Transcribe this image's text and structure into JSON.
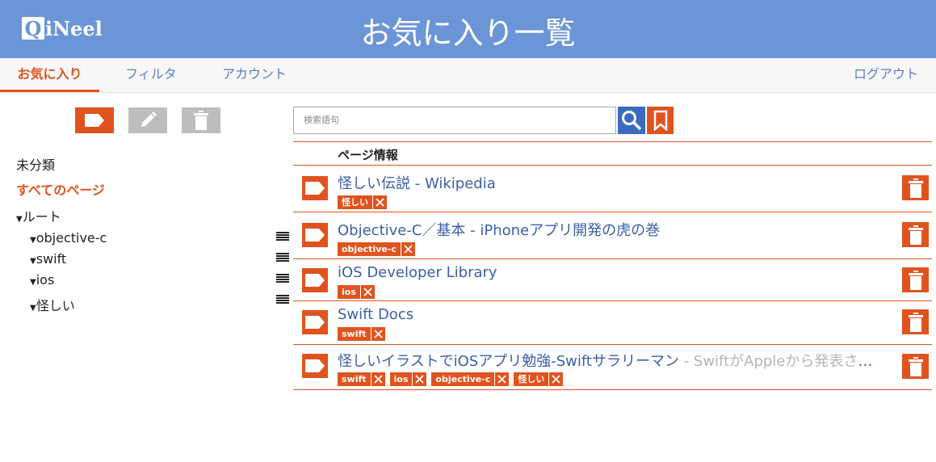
{
  "header": {
    "logo_letter": "Q",
    "logo_text": "iNeel",
    "title": "お気に入り一覧"
  },
  "tabs": [
    {
      "label": "お気に入り",
      "active": true
    },
    {
      "label": "フィルタ",
      "active": false
    },
    {
      "label": "アカウント",
      "active": false
    }
  ],
  "logout_label": "ログアウト",
  "sidebar": {
    "toolbar_icons": [
      "tag-icon",
      "pencil-icon",
      "trash-icon"
    ],
    "uncategorized": "未分類",
    "all_pages": "すべてのページ",
    "root": "ルート",
    "folders": [
      {
        "label": "objective-c"
      },
      {
        "label": "swift"
      },
      {
        "label": "ios"
      },
      {
        "label": "怪しい"
      }
    ]
  },
  "search": {
    "placeholder": "検索語句",
    "value": ""
  },
  "table": {
    "header": "ページ情報",
    "rows": [
      {
        "title": "怪しい伝説 - Wikipedia",
        "description": "",
        "tags": [
          "怪しい"
        ]
      },
      {
        "title": "Objective-C／基本 - iPhoneアプリ開発の虎の巻",
        "description": "",
        "tags": [
          "objective-c"
        ]
      },
      {
        "title": "iOS Developer Library",
        "description": "",
        "tags": [
          "ios"
        ]
      },
      {
        "title": "Swift Docs",
        "description": "",
        "tags": [
          "swift"
        ]
      },
      {
        "title": "怪しいイラストでiOSアプリ勉強-Swiftサラリーマン",
        "description": " - SwiftがAppleから発表され…",
        "tags": [
          "swift",
          "ios",
          "objective-c",
          "怪しい"
        ]
      }
    ]
  },
  "colors": {
    "header_bg": "#6b95d6",
    "accent": "#e0531e",
    "link": "#3b5fa5",
    "search_button": "#3b6bc0",
    "disabled": "#bdbdbd"
  }
}
